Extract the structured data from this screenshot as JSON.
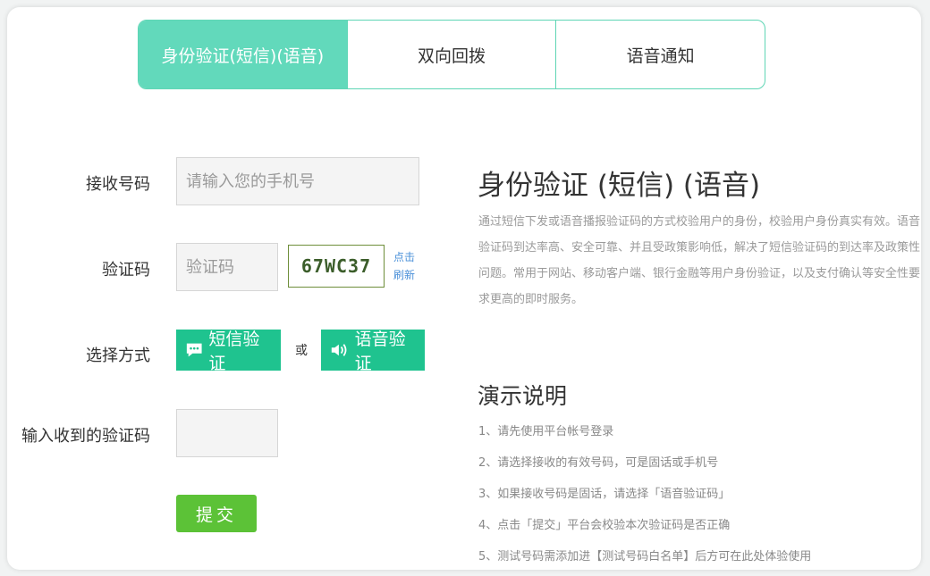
{
  "tabs": [
    {
      "label": "身份验证(短信)(语音)",
      "active": true
    },
    {
      "label": "双向回拨",
      "active": false
    },
    {
      "label": "语音通知",
      "active": false
    }
  ],
  "form": {
    "phone_label": "接收号码",
    "phone_placeholder": "请输入您的手机号",
    "code_label": "验证码",
    "code_placeholder": "验证码",
    "captcha_text": "67WC37",
    "refresh_label": "点击刷新",
    "method_label": "选择方式",
    "sms_button": "短信验证",
    "or_text": "或",
    "voice_button": "语音验证",
    "received_label": "输入收到的验证码",
    "received_value": "",
    "submit_label": "提交"
  },
  "info": {
    "title": "身份验证 (短信) (语音)",
    "description": "通过短信下发或语音播报验证码的方式校验用户的身份，校验用户身份真实有效。语音验证码到达率高、安全可靠、并且受政策影响低，解决了短信验证码的到达率及政策性问题。常用于网站、移动客户端、银行金融等用户身份验证，以及支付确认等安全性要求更高的即时服务。",
    "demo_title": "演示说明",
    "steps": [
      "1、请先使用平台帐号登录",
      "2、请选择接收的有效号码，可是固话或手机号",
      "3、如果接收号码是固话，请选择「语音验证码」",
      "4、点击「提交」平台会校验本次验证码是否正确",
      "5、测试号码需添加进【测试号码白名单】后方可在此处体验使用"
    ]
  },
  "colors": {
    "tab_active": "#62d9bb",
    "method_button": "#1fc38f",
    "submit_button": "#5cc237",
    "refresh_link": "#4a90d9"
  }
}
